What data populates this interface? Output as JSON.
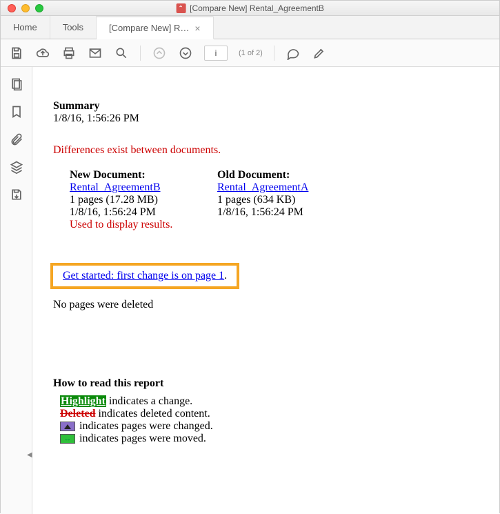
{
  "window": {
    "title": "[Compare New] Rental_AgreementB",
    "pdf_glyph": "▸"
  },
  "tabs": {
    "home": "Home",
    "tools": "Tools",
    "active": "[Compare New] R…",
    "close_glyph": "×"
  },
  "toolbar": {
    "page_value": "i",
    "page_count": "(1 of 2)"
  },
  "summary": {
    "heading": "Summary",
    "timestamp": "1/8/16, 1:56:26 PM",
    "diff_msg": "Differences exist between documents.",
    "new": {
      "header": "New Document:",
      "link": "Rental_AgreementB",
      "pages": "1 pages (17.28 MB)",
      "time": "1/8/16, 1:56:24 PM",
      "used": "Used to display results."
    },
    "old": {
      "header": "Old Document:",
      "link": "Rental_AgreementA",
      "pages": "1 pages (634 KB)",
      "time": "1/8/16, 1:56:24 PM"
    },
    "get_started": "Get started: first change is on page 1",
    "get_started_period": ".",
    "no_pages_deleted": "No pages were deleted"
  },
  "howto": {
    "heading": "How to read this report",
    "highlight_word": "Highlight",
    "highlight_rest": " indicates a change.",
    "deleted_word": "Deleted",
    "deleted_rest": " indicates deleted content.",
    "changed_rest": " indicates pages were changed.",
    "moved_rest": " indicates pages were moved."
  }
}
